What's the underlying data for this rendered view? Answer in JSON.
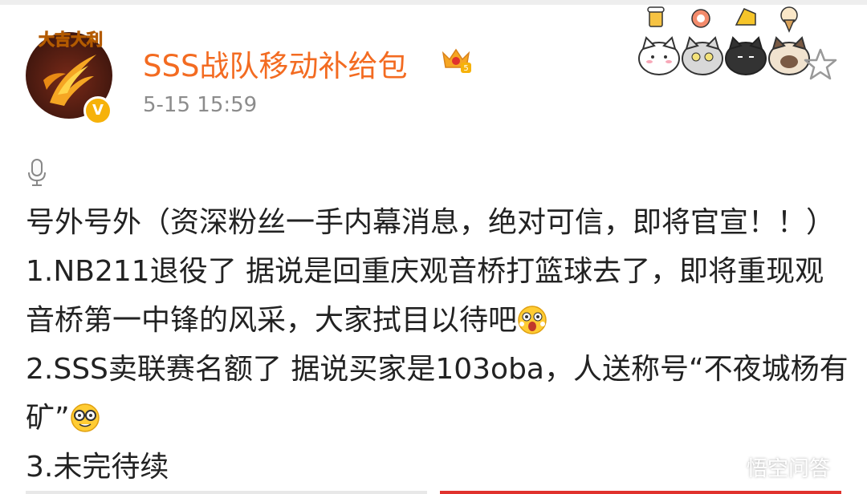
{
  "post": {
    "username": "SSS战队移动补给包",
    "timestamp": "5-15 15:59",
    "avatar_text": "大吉大利",
    "verified_badge": "V",
    "crown_level": "5"
  },
  "content": {
    "line1": "号外号外（资深粉丝一手内幕消息，绝对可信，即将官宣！！）",
    "item1": "1.NB211退役了 据说是回重庆观音桥打篮球去了，即将重现观音桥第一中锋的风采，大家拭目以待吧",
    "item2": "2.SSS卖联赛名额了 据说买家是103oba，人送称号“不夜城杨有矿”",
    "item3": "3.未完待续"
  },
  "icons": {
    "mic": "microphone-icon",
    "emoji1": "surprised-face-emoji",
    "emoji2": "nerd-face-emoji",
    "star": "star-icon"
  },
  "watermark": {
    "text": "悟空问答"
  },
  "colors": {
    "username": "#f36b21",
    "timestamp": "#8c8c8c",
    "badge": "#f6b20a"
  }
}
